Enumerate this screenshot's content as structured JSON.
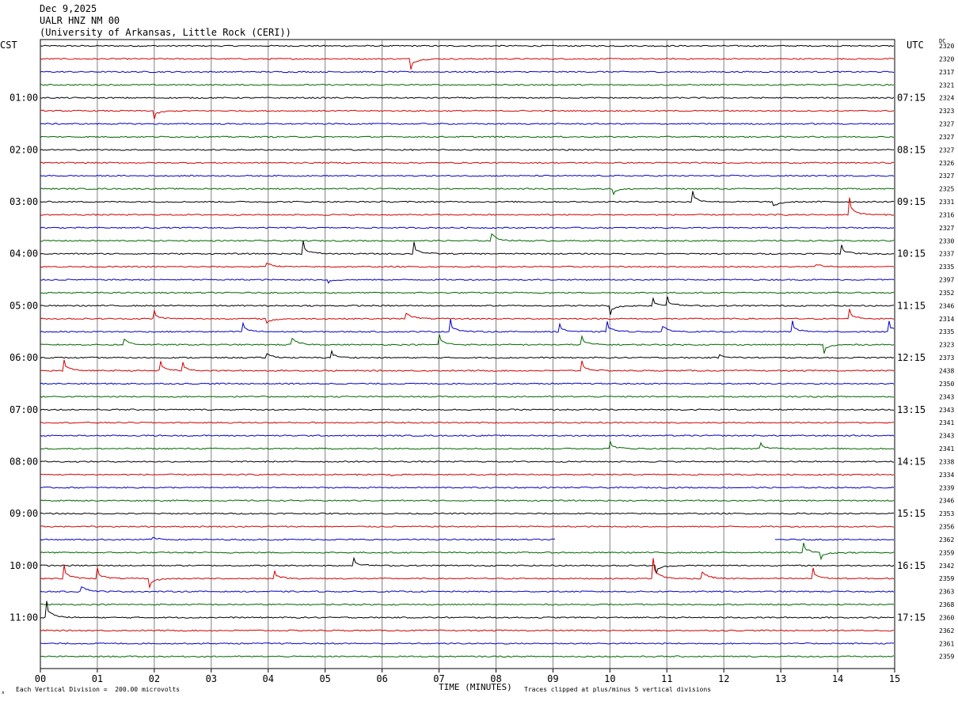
{
  "header": {
    "date": "Dec 9,2025",
    "station": "UALR HNZ NM 00",
    "network": "(University of Arkansas, Little Rock (CERI))"
  },
  "left_tz": "CST",
  "right_tz": "UTC",
  "dc_label": "DC",
  "footer": {
    "scale": "Each Vertical Division =  200.00 microvolts",
    "clip": "Traces clipped at plus/minus 5 vertical divisions"
  },
  "logo": "∧",
  "colors": {
    "black": "#000000",
    "red": "#d40000",
    "blue": "#0000c8",
    "green": "#006400",
    "grid": "#808080"
  },
  "chart_data": {
    "type": "line",
    "title": "UALR HNZ NM 00",
    "xlabel": "TIME (MINUTES)",
    "ylabel": "",
    "xlim": [
      0,
      15
    ],
    "x_ticks": [
      "00",
      "01",
      "02",
      "03",
      "04",
      "05",
      "06",
      "07",
      "08",
      "09",
      "10",
      "11",
      "12",
      "13",
      "14",
      "15"
    ],
    "trace_interval_minutes": 15,
    "trace_colors_cycle": [
      "black",
      "red",
      "blue",
      "green"
    ],
    "left_hour_labels": [
      "01:00",
      "02:00",
      "03:00",
      "04:00",
      "05:00",
      "06:00",
      "07:00",
      "08:00",
      "09:00",
      "10:00",
      "11:00"
    ],
    "right_hour_labels": [
      "07:15",
      "08:15",
      "09:15",
      "10:15",
      "11:15",
      "12:15",
      "13:15",
      "14:15",
      "15:15",
      "16:15",
      "17:15"
    ],
    "hour_label_first_trace": 4,
    "dc_values": [
      2320,
      2320,
      2317,
      2321,
      2324,
      2323,
      2327,
      2327,
      2327,
      2326,
      2327,
      2325,
      2331,
      2316,
      2327,
      2330,
      2337,
      2335,
      2397,
      2352,
      2346,
      2314,
      2335,
      2323,
      2373,
      2438,
      2350,
      2343,
      2343,
      2341,
      2343,
      2341,
      2338,
      2334,
      2339,
      2346,
      2353,
      2356,
      2362,
      2359,
      2342,
      2359,
      2363,
      2368,
      2360,
      2362,
      2361,
      2359
    ],
    "events": [
      {
        "trace": 1,
        "minute": 6.5,
        "amp": -14
      },
      {
        "trace": 5,
        "minute": 2.0,
        "amp": -10
      },
      {
        "trace": 11,
        "minute": 10.05,
        "amp": -8
      },
      {
        "trace": 12,
        "minute": 11.45,
        "amp": 14
      },
      {
        "trace": 12,
        "minute": 12.85,
        "amp": -14
      },
      {
        "trace": 13,
        "minute": 14.2,
        "amp": 24
      },
      {
        "trace": 15,
        "minute": 7.9,
        "amp": 20
      },
      {
        "trace": 16,
        "minute": 4.6,
        "amp": 18
      },
      {
        "trace": 16,
        "minute": 6.55,
        "amp": 16
      },
      {
        "trace": 16,
        "minute": 14.05,
        "amp": 14
      },
      {
        "trace": 17,
        "minute": 3.95,
        "amp": 12
      },
      {
        "trace": 17,
        "minute": 13.6,
        "amp": 8
      },
      {
        "trace": 18,
        "minute": 5.05,
        "amp": -4
      },
      {
        "trace": 20,
        "minute": 10.0,
        "amp": -12
      },
      {
        "trace": 20,
        "minute": 10.75,
        "amp": 10
      },
      {
        "trace": 20,
        "minute": 11.0,
        "amp": 12
      },
      {
        "trace": 21,
        "minute": 2.0,
        "amp": 10
      },
      {
        "trace": 21,
        "minute": 3.95,
        "amp": -12
      },
      {
        "trace": 21,
        "minute": 6.4,
        "amp": 18
      },
      {
        "trace": 21,
        "minute": 14.2,
        "amp": 14
      },
      {
        "trace": 22,
        "minute": 3.55,
        "amp": 12
      },
      {
        "trace": 22,
        "minute": 7.2,
        "amp": 16
      },
      {
        "trace": 22,
        "minute": 9.1,
        "amp": 12
      },
      {
        "trace": 22,
        "minute": 9.95,
        "amp": 14
      },
      {
        "trace": 22,
        "minute": 10.9,
        "amp": 16
      },
      {
        "trace": 22,
        "minute": 13.2,
        "amp": 14
      },
      {
        "trace": 22,
        "minute": 14.9,
        "amp": 14
      },
      {
        "trace": 23,
        "minute": 1.45,
        "amp": 16
      },
      {
        "trace": 23,
        "minute": 4.4,
        "amp": 18
      },
      {
        "trace": 23,
        "minute": 7.0,
        "amp": 14
      },
      {
        "trace": 23,
        "minute": 9.5,
        "amp": 12
      },
      {
        "trace": 23,
        "minute": 13.75,
        "amp": -12
      },
      {
        "trace": 24,
        "minute": 3.95,
        "amp": 12
      },
      {
        "trace": 24,
        "minute": 5.1,
        "amp": 10
      },
      {
        "trace": 24,
        "minute": 11.9,
        "amp": 10
      },
      {
        "trace": 25,
        "minute": 0.4,
        "amp": 16
      },
      {
        "trace": 25,
        "minute": 2.1,
        "amp": 14
      },
      {
        "trace": 25,
        "minute": 2.5,
        "amp": 10
      },
      {
        "trace": 25,
        "minute": 9.5,
        "amp": 14
      },
      {
        "trace": 31,
        "minute": 10.0,
        "amp": 10
      },
      {
        "trace": 31,
        "minute": 12.65,
        "amp": 8
      },
      {
        "trace": 33,
        "minute": 6.15,
        "amp": -3
      },
      {
        "trace": 38,
        "minute": 1.95,
        "amp": 6
      },
      {
        "trace": 39,
        "minute": 13.4,
        "amp": 12
      },
      {
        "trace": 39,
        "minute": 13.7,
        "amp": -10
      },
      {
        "trace": 40,
        "minute": 5.5,
        "amp": 10
      },
      {
        "trace": 40,
        "minute": 10.8,
        "amp": -12
      },
      {
        "trace": 41,
        "minute": 0.4,
        "amp": 20
      },
      {
        "trace": 41,
        "minute": 1.0,
        "amp": 14
      },
      {
        "trace": 41,
        "minute": 1.9,
        "amp": -14
      },
      {
        "trace": 41,
        "minute": 4.1,
        "amp": 12
      },
      {
        "trace": 41,
        "minute": 10.75,
        "amp": 28
      },
      {
        "trace": 41,
        "minute": 11.6,
        "amp": 20
      },
      {
        "trace": 41,
        "minute": 13.55,
        "amp": 16
      },
      {
        "trace": 42,
        "minute": 0.7,
        "amp": 16
      },
      {
        "trace": 44,
        "minute": 0.1,
        "amp": 24
      }
    ],
    "gaps": [
      {
        "trace": 38,
        "from": 9.05,
        "to": 10.8
      },
      {
        "trace": 38,
        "from": 10.8,
        "to": 12.9
      }
    ]
  }
}
